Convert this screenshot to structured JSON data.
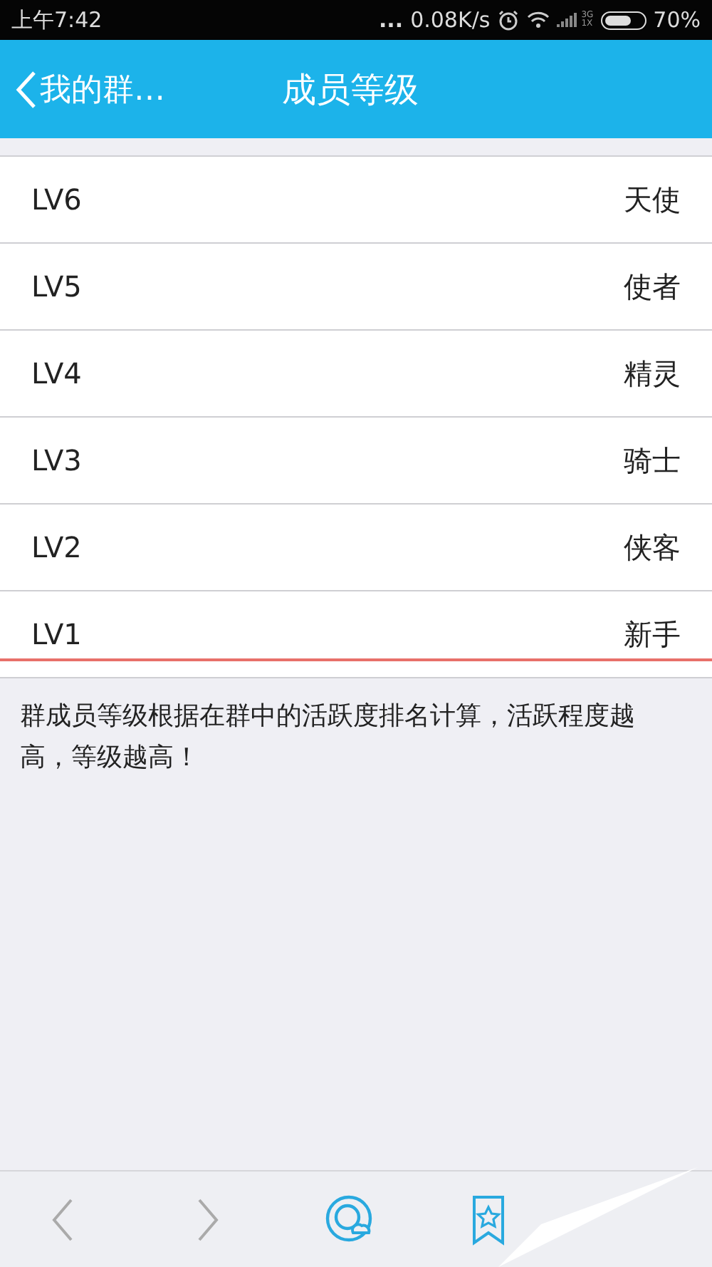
{
  "status_bar": {
    "time": "上午7:42",
    "dots": "...",
    "speed": "0.08K/s",
    "network": [
      "3G",
      "1X"
    ],
    "battery": "70%"
  },
  "header": {
    "back_label": "我的群…",
    "title": "成员等级"
  },
  "levels": [
    {
      "level": "LV6",
      "name": "天使"
    },
    {
      "level": "LV5",
      "name": "使者"
    },
    {
      "level": "LV4",
      "name": "精灵"
    },
    {
      "level": "LV3",
      "name": "骑士"
    },
    {
      "level": "LV2",
      "name": "侠客"
    },
    {
      "level": "LV1",
      "name": "新手"
    }
  ],
  "note": "群成员等级根据在群中的活跃度排名计算，活跃程度越高，等级越高！",
  "bottom_bar": [
    {
      "kind": "back"
    },
    {
      "kind": "forward"
    },
    {
      "kind": "qzone"
    },
    {
      "kind": "favorite"
    }
  ]
}
